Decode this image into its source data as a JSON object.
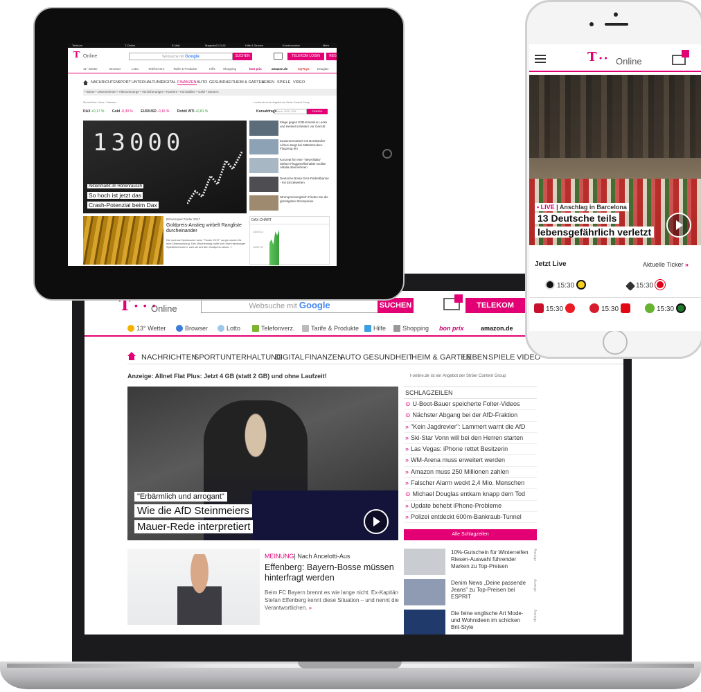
{
  "laptop": {
    "logo_t": "T",
    "logo_dots": "• • •",
    "logo_online": "Online",
    "search_placeholder": "Websuche mit",
    "search_brand": "Google",
    "search_button": "SUCHEN",
    "login_button": "TELEKOM LOGIN",
    "service_bar": {
      "weather": "13° Wetter",
      "browser": "Browser",
      "lotto": "Lotto",
      "telefon": "Telefonverz.",
      "tarife": "Tarife & Produkte",
      "hilfe": "Hilfe",
      "shopping": "Shopping",
      "bonprix": "bon prix",
      "amazon": "amazon.de"
    },
    "nav": [
      "NACHRICHTEN",
      "SPORT",
      "UNTERHALTUNG",
      "DIGITAL",
      "FINANZEN",
      "AUTO",
      "GESUNDHEIT",
      "HEIM & GARTEN",
      "LEBEN",
      "SPIELE",
      "VIDEO"
    ],
    "ad_text": "Anzeige: Allnet Flat Plus: Jetzt 4 GB (statt 2 GB) und ohne Laufzeit!",
    "ad_note": "t-online.de ist ein Angebot der Ströer Content Group",
    "hero": {
      "kicker": "\"Erbärmlich und arrogant\"",
      "title_line1": "Wie die AfD Steinmeiers",
      "title_line2": "Mauer-Rede interpretiert"
    },
    "headlines_title": "SCHLAGZEILEN",
    "headlines": [
      {
        "marker": "⊙",
        "text": "U-Boot-Bauer speicherte Folter-Videos"
      },
      {
        "marker": "⊙",
        "text": "Nächster Abgang bei der AfD-Fraktion"
      },
      {
        "marker": "»",
        "text": "\"Kein Jagdrevier\": Lammert warnt die AfD"
      },
      {
        "marker": "»",
        "text": "Ski-Star Vonn will bei den Herren starten"
      },
      {
        "marker": "»",
        "text": "Las Vegas: iPhone rettet Besitzerin"
      },
      {
        "marker": "»",
        "text": "WM-Arena muss erweitert werden"
      },
      {
        "marker": "»",
        "text": "Amazon muss 250 Millionen zahlen"
      },
      {
        "marker": "»",
        "text": "Falscher Alarm weckt 2,4 Mio. Menschen"
      },
      {
        "marker": "⊙",
        "text": "Michael Douglas entkam knapp dem Tod"
      },
      {
        "marker": "»",
        "text": "Update behebt iPhone-Probleme"
      },
      {
        "marker": "»",
        "text": "Polizei entdeckt 600m-Bankraub-Tunnel"
      }
    ],
    "headlines_button": "Alle Schlagzeilen",
    "article": {
      "kicker_label": "MEINUNG",
      "kicker_rest": "| Nach Ancelotti-Aus",
      "title": "Effenberg: Bayern-Bosse müssen hinterfragt werden",
      "text": "Beim FC Bayern brennt es wie lange nicht. Ex-Kapitän Stefan Effenberg kennt diese Situation – und nennt die Verantwortlichen.",
      "more": "»"
    },
    "promos": [
      {
        "text": "10%-Gutschein für Winterreifen Riesen-Auswahl führender Marken zu Top-Preisen",
        "side": "Anzeige",
        "color": "#c9ccd1"
      },
      {
        "text": "Denim News „Deine passende Jeans\" zu Top-Preisen bei ESPRIT",
        "side": "Anzeige",
        "color": "#8e9bb3"
      },
      {
        "text": "Die feine englische Art Mode- und Wohnideen im schicken Brit-Style",
        "side": "Anzeige",
        "color": "#1f3a6b"
      }
    ]
  },
  "tablet": {
    "topbar": [
      "Telekom",
      "T-Online",
      "E-Mail",
      "MagentaCLOUD",
      "Hilfe & Service",
      "Kundencenter",
      "Mehr"
    ],
    "logo_t": "T",
    "logo_online": "Online",
    "search_placeholder": "Websuche mit",
    "search_brand": "Google",
    "search_button": "SUCHEN",
    "login_button": "TELEKOM LOGIN",
    "register_button": "REGISTRIEREN",
    "service_bar": [
      "11° Wetter",
      "Browser",
      "Lotto",
      "Telefonverz.",
      "Tarife & Produkte",
      "Hilfe",
      "Shopping",
      "bon prix",
      "amazon.de",
      "myToys",
      "Douglas"
    ],
    "nav": [
      "NACHRICHTEN",
      "SPORT",
      "UNTERHALTUNG",
      "DIGITAL",
      "FINANZEN",
      "AUTO",
      "GESUNDHEIT",
      "HEIM & GARTEN",
      "LEBEN",
      "SPIELE",
      "VIDEO"
    ],
    "subnav": "• Börse  • Unternehmen  • Altersvorsorge  • Versicherungen  • Karriere  • Immobilien  • Geld  • Steuern",
    "breadcrumb": "Sie sind hier: Home › Finanzen",
    "breadcrumb_right": "t-online.de ist ein Angebot der Ströer Content Group",
    "ticker": [
      {
        "label": "DAX",
        "value": "+0,17 %",
        "dir": "up"
      },
      {
        "label": "Gold",
        "value": "-0,30 %",
        "dir": "dn"
      },
      {
        "label": "EUR/USD",
        "value": "-0,16 %",
        "dir": "dn"
      },
      {
        "label": "Rohöl WTI",
        "value": "+0,81 %",
        "dir": "up"
      }
    ],
    "kurs_label": "Kursabfrage",
    "kurs_placeholder": "Name, WKN, ISIN...",
    "kurs_button": "FINDEN",
    "hero": {
      "number": "13000",
      "kicker": "Aktienmarkt im Höhenrausch",
      "line1": "So hoch ist jetzt das",
      "line2": "Crash-Potenzial beim Dax"
    },
    "side_news": [
      {
        "text": "Klage gegen E2B-Krisenlux Lucke und Henkel scheitern vor Gericht",
        "color": "#5b6d7a"
      },
      {
        "text": "Zusammenarbeit mit Bombardier Airbus steigt bei Mittelstrecken-Flugzeug ein",
        "color": "#8ea2b5"
      },
      {
        "text": "Konzept für eine \"NewAlitalia\" Sieben Fluggesellschaften wollen Alitalia übernehmen",
        "color": "#a7b7c4"
      },
      {
        "text": "Deutsche Börse DAX-Parkettbanne - mit Einzelwerten",
        "color": "#4d4d52"
      },
      {
        "text": "Strompreisvergleich Finden Sie die günstigsten Strompreise",
        "color": "#9d8a6f"
      }
    ],
    "gold": {
      "kicker": "Börsenspiel Trader 2017",
      "title": "Goldpreis-Anstieg wirbelt Rangliste durcheinander",
      "text": "Die sechste Spielwoche beim \"Trader 2017\" sorgte wieder für eine Überraschung. Den Wochensieg holte sich eine Hamburger Spielteilnehmerin, weil sie auf den Goldpreis setzte. »"
    },
    "dax_chart": {
      "title": "DAX-CHART",
      "label_top": "13019,16",
      "label_mid": "12937,93"
    }
  },
  "phone": {
    "logo_t": "T",
    "logo_online": "Online",
    "hero": {
      "live": "• LIVE",
      "live_rest": "| Anschlag in Barcelona",
      "line1": "13 Deutsche teils",
      "line2": "lebensgefährlich verletzt"
    },
    "live_label": "Jetzt Live",
    "ticker_label": "Aktuelle Ticker",
    "ticker_arrow": "»",
    "matches_row1": [
      {
        "time": "15:30",
        "home_color": "#111111",
        "away_color": "#f7d117"
      },
      {
        "time": "15:30",
        "home_color": "#333333",
        "away_color": "#e2001a"
      }
    ],
    "matches_row2": [
      {
        "time": "15:30",
        "home_color": "#c8102e",
        "away_color": "#ed1c24"
      },
      {
        "time": "15:30",
        "home_color": "#d51d2d",
        "away_color": "#65b32e"
      },
      {
        "time": "15:30",
        "home_color": "#e30613",
        "away_color": "#1f7a2e"
      }
    ]
  }
}
